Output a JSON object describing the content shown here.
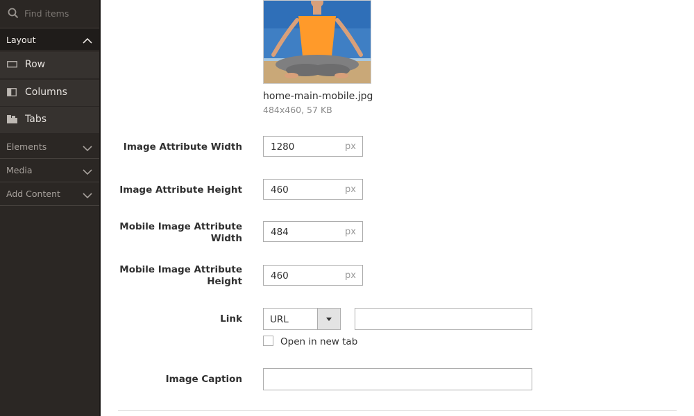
{
  "sidebar": {
    "search_placeholder": "Find items",
    "layout_section": {
      "label": "Layout",
      "expanded": true,
      "items": [
        {
          "label": "Row",
          "icon": "row-icon"
        },
        {
          "label": "Columns",
          "icon": "columns-icon"
        },
        {
          "label": "Tabs",
          "icon": "tabs-icon"
        }
      ]
    },
    "collapsed_sections": [
      {
        "label": "Elements"
      },
      {
        "label": "Media"
      },
      {
        "label": "Add Content"
      }
    ]
  },
  "image_preview": {
    "filename": "home-main-mobile.jpg",
    "meta": "484x460, 57 KB"
  },
  "fields": {
    "width": {
      "label": "Image Attribute Width",
      "value": "1280",
      "unit": "px"
    },
    "height": {
      "label": "Image Attribute Height",
      "value": "460",
      "unit": "px"
    },
    "mobile_width": {
      "label": "Mobile Image Attribute Width",
      "value": "484",
      "unit": "px"
    },
    "mobile_height": {
      "label": "Mobile Image Attribute Height",
      "value": "460",
      "unit": "px"
    },
    "link": {
      "label": "Link",
      "type_selected": "URL",
      "url_value": "",
      "open_new_tab_label": "Open in new tab",
      "open_new_tab_checked": false
    },
    "caption": {
      "label": "Image Caption",
      "value": ""
    }
  },
  "colors": {
    "sidebar_bg": "#2b2724",
    "sidebar_item_bg": "#36322f",
    "text": "#303030",
    "border": "#adadad"
  }
}
